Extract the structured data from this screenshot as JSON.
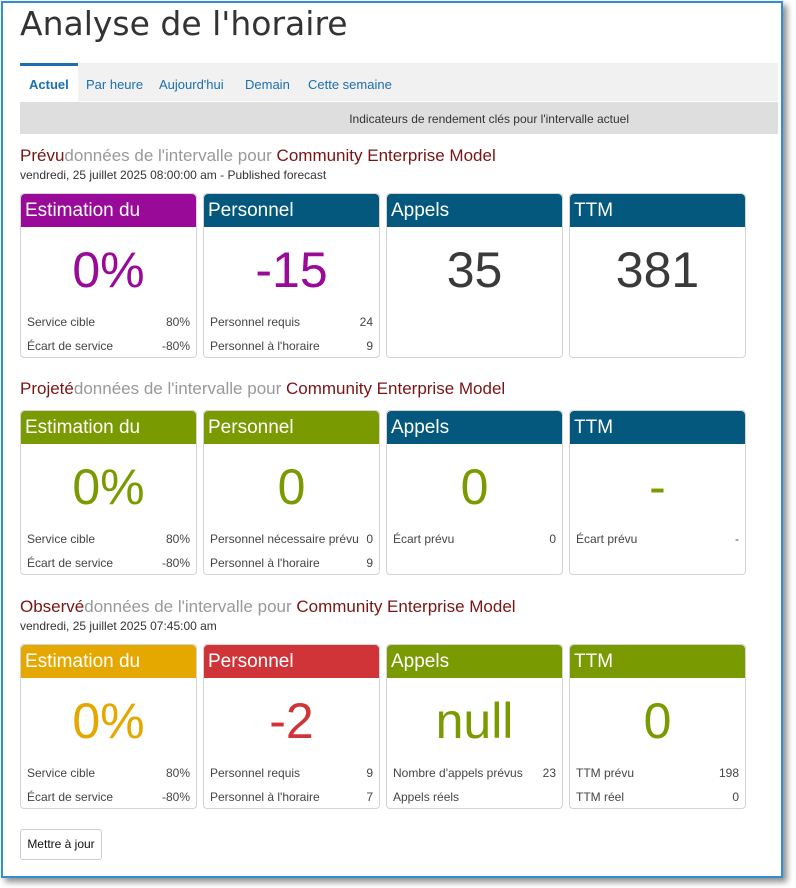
{
  "page_title": "Analyse de l'horaire",
  "tabs": [
    "Actuel",
    "Par heure",
    "Aujourd'hui",
    "Demain",
    "Cette semaine"
  ],
  "subheader": "Indicateurs de rendement clés pour l'intervalle actuel",
  "sections": [
    {
      "keyword": "Prévu",
      "rest": "données de l'intervalle pour ",
      "model": "Community Enterprise Model",
      "date": "vendredi, 25 juillet 2025 08:00:00 am - Published forecast",
      "cards": [
        {
          "head": "Estimation du",
          "value": "0%",
          "rows": [
            [
              "Service cible",
              "80%"
            ],
            [
              "Écart de service",
              "-80%"
            ]
          ]
        },
        {
          "head": "Personnel",
          "value": "-15",
          "rows": [
            [
              "Personnel requis",
              "24"
            ],
            [
              "Personnel à l'horaire",
              "9"
            ]
          ]
        },
        {
          "head": "Appels",
          "value": "35",
          "rows": []
        },
        {
          "head": "TTM",
          "value": "381",
          "rows": []
        }
      ]
    },
    {
      "keyword": "Projeté",
      "rest": "données de l'intervalle pour ",
      "model": "Community Enterprise Model",
      "date": "",
      "cards": [
        {
          "head": "Estimation du",
          "value": "0%",
          "rows": [
            [
              "Service cible",
              "80%"
            ],
            [
              "Écart de service",
              "-80%"
            ]
          ]
        },
        {
          "head": "Personnel",
          "value": "0",
          "rows": [
            [
              "Personnel nécessaire prévu",
              "0"
            ],
            [
              "Personnel à l'horaire",
              "9"
            ]
          ]
        },
        {
          "head": "Appels",
          "value": "0",
          "rows": [
            [
              "Écart prévu",
              "0"
            ]
          ]
        },
        {
          "head": "TTM",
          "value": "-",
          "rows": [
            [
              "Écart prévu",
              "-"
            ]
          ]
        }
      ]
    },
    {
      "keyword": "Observé",
      "rest": "données de l'intervalle pour ",
      "model": "Community Enterprise Model",
      "date": "vendredi, 25 juillet 2025 07:45:00 am",
      "cards": [
        {
          "head": "Estimation du",
          "value": "0%",
          "rows": [
            [
              "Service cible",
              "80%"
            ],
            [
              "Écart de service",
              "-80%"
            ]
          ]
        },
        {
          "head": "Personnel",
          "value": "-2",
          "rows": [
            [
              "Personnel requis",
              "9"
            ],
            [
              "Personnel à l'horaire",
              "7"
            ]
          ]
        },
        {
          "head": "Appels",
          "value": "null",
          "rows": [
            [
              "Nombre d'appels prévus",
              "23"
            ],
            [
              "Appels réels",
              ""
            ]
          ]
        },
        {
          "head": "TTM",
          "value": "0",
          "rows": [
            [
              "TTM prévu",
              "198"
            ],
            [
              "TTM réel",
              "0"
            ]
          ]
        }
      ]
    }
  ],
  "update_button": "Mettre à jour",
  "colors": {
    "purple": "#990a99",
    "navy": "#04577d",
    "olive": "#7a9a01",
    "gold": "#e5a800",
    "red": "#d13438",
    "dark_text": "#3a3a3a",
    "tab_blue": "#1a6fb0",
    "section_keyword": "#7a1414"
  }
}
